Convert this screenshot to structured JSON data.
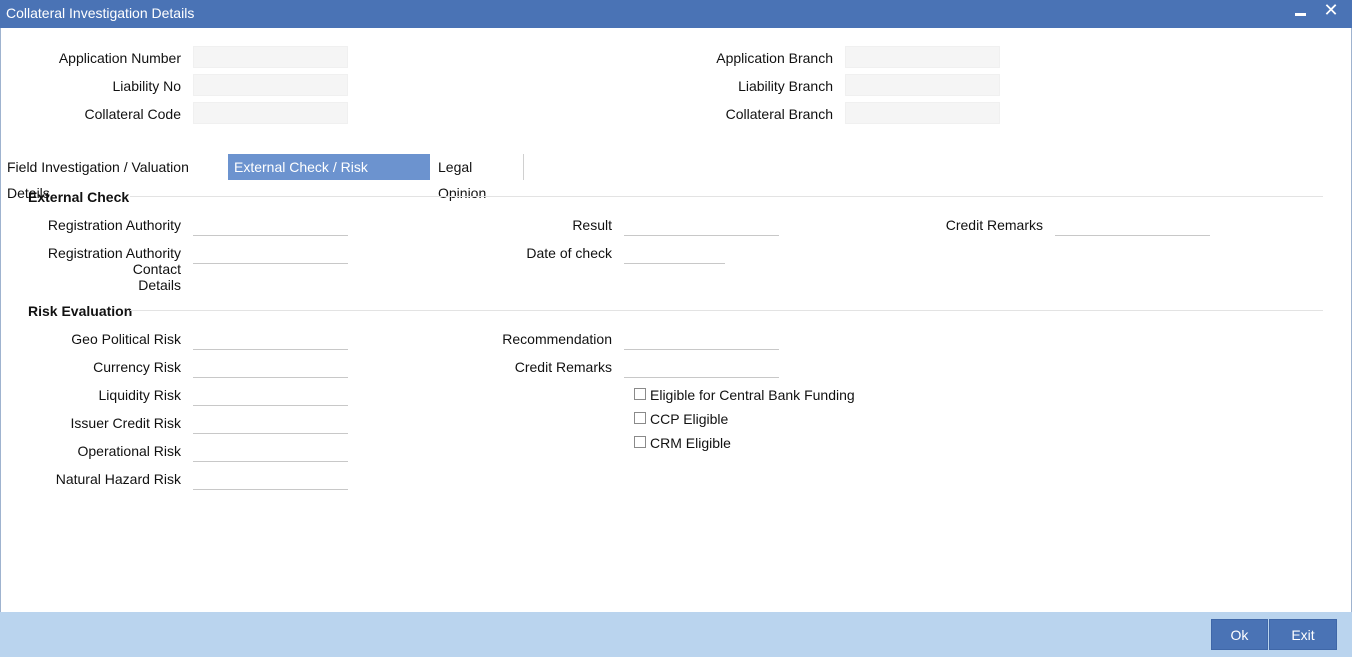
{
  "window": {
    "title": "Collateral Investigation Details",
    "minimize_icon": "minimize-icon",
    "close_icon": "close-icon",
    "close_glyph": "✕"
  },
  "header": {
    "application_number": {
      "label": "Application Number",
      "value": ""
    },
    "liability_no": {
      "label": "Liability No",
      "value": ""
    },
    "collateral_code": {
      "label": "Collateral Code",
      "value": ""
    },
    "application_branch": {
      "label": "Application Branch",
      "value": ""
    },
    "liability_branch": {
      "label": "Liability Branch",
      "value": ""
    },
    "collateral_branch": {
      "label": "Collateral Branch",
      "value": ""
    }
  },
  "tabs": [
    {
      "label": "Field Investigation / Valuation Details",
      "active": false
    },
    {
      "label": "External Check / Risk Evaluation",
      "active": true
    },
    {
      "label": "Legal Opinion",
      "active": false
    }
  ],
  "external_check": {
    "title": "External Check",
    "registration_authority": {
      "label": "Registration Authority",
      "value": ""
    },
    "registration_authority_contact": {
      "label_line1": "Registration Authority Contact",
      "label_line2": "Details",
      "value": ""
    },
    "result": {
      "label": "Result",
      "value": ""
    },
    "date_of_check": {
      "label": "Date of check",
      "value": ""
    },
    "credit_remarks": {
      "label": "Credit Remarks",
      "value": ""
    }
  },
  "risk_evaluation": {
    "title": "Risk Evaluation",
    "geo_political_risk": {
      "label": "Geo Political Risk",
      "value": ""
    },
    "currency_risk": {
      "label": "Currency Risk",
      "value": ""
    },
    "liquidity_risk": {
      "label": "Liquidity Risk",
      "value": ""
    },
    "issuer_credit_risk": {
      "label": "Issuer Credit Risk",
      "value": ""
    },
    "operational_risk": {
      "label": "Operational Risk",
      "value": ""
    },
    "natural_hazard_risk": {
      "label": "Natural Hazard Risk",
      "value": ""
    },
    "recommendation": {
      "label": "Recommendation",
      "value": ""
    },
    "credit_remarks": {
      "label": "Credit Remarks",
      "value": ""
    },
    "eligible_cb_funding": {
      "label": "Eligible for Central Bank Funding",
      "checked": false
    },
    "ccp_eligible": {
      "label": "CCP Eligible",
      "checked": false
    },
    "crm_eligible": {
      "label": "CRM Eligible",
      "checked": false
    }
  },
  "footer": {
    "ok_label": "Ok",
    "exit_label": "Exit"
  },
  "colors": {
    "title_bar": "#4a73b5",
    "active_tab": "#6c93cf",
    "footer": "#bad4ee",
    "button": "#4a73b5"
  }
}
